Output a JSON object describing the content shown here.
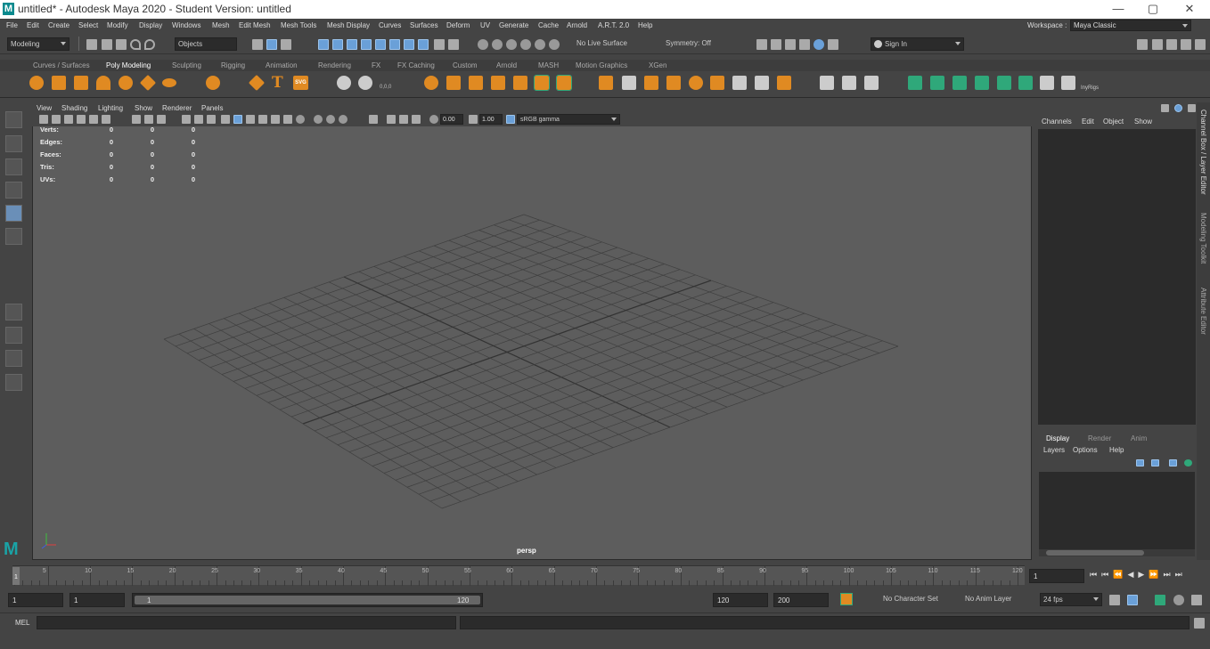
{
  "window": {
    "title": "untitled* - Autodesk Maya 2020 - Student Version: untitled",
    "logo": "M",
    "minimize": "—",
    "maximize": "▢",
    "close": "✕"
  },
  "menubar": {
    "items": [
      "File",
      "Edit",
      "Create",
      "Select",
      "Modify",
      "Display",
      "Windows",
      "Mesh",
      "Edit Mesh",
      "Mesh Tools",
      "Mesh Display",
      "Curves",
      "Surfaces",
      "Deform",
      "UV",
      "Generate",
      "Cache",
      "Arnold",
      "A.R.T. 2.0",
      "Help"
    ],
    "workspace_label": "Workspace :",
    "workspace_value": "Maya Classic"
  },
  "statusline": {
    "mode": "Modeling",
    "select_mode": "Objects",
    "live_surface": "No Live Surface",
    "symmetry": "Symmetry: Off",
    "sign_in": "Sign In"
  },
  "shelf": {
    "tabs": [
      "Curves / Surfaces",
      "Poly Modeling",
      "Sculpting",
      "Rigging",
      "Animation",
      "Rendering",
      "FX",
      "FX Caching",
      "Custom",
      "Arnold",
      "MASH",
      "Motion Graphics",
      "XGen"
    ],
    "active_tab": "Poly Modeling",
    "text_tool": "T",
    "svg_tool": "SVG",
    "mirror_label": "0,0,0",
    "iny_label": "InyRigs"
  },
  "viewport": {
    "menu": [
      "View",
      "Shading",
      "Lighting",
      "Show",
      "Renderer",
      "Panels"
    ],
    "exposure": "0.00",
    "gamma": "1.00",
    "color_space": "sRGB gamma",
    "camera": "persp",
    "hud": [
      {
        "label": "Verts:",
        "a": "0",
        "b": "0",
        "c": "0"
      },
      {
        "label": "Edges:",
        "a": "0",
        "b": "0",
        "c": "0"
      },
      {
        "label": "Faces:",
        "a": "0",
        "b": "0",
        "c": "0"
      },
      {
        "label": "Tris:",
        "a": "0",
        "b": "0",
        "c": "0"
      },
      {
        "label": "UVs:",
        "a": "0",
        "b": "0",
        "c": "0"
      }
    ]
  },
  "channelbox": {
    "menu": [
      "Channels",
      "Edit",
      "Object",
      "Show"
    ]
  },
  "layereditor": {
    "tabs": [
      "Display",
      "Render",
      "Anim"
    ],
    "menu": [
      "Layers",
      "Options",
      "Help"
    ]
  },
  "sidetabs": [
    "Channel Box / Layer Editor",
    "Modeling Toolkit",
    "Attribute Editor"
  ],
  "timeslider": {
    "ticks": [
      "5",
      "10",
      "15",
      "20",
      "25",
      "30",
      "35",
      "40",
      "45",
      "50",
      "55",
      "60",
      "65",
      "70",
      "75",
      "80",
      "85",
      "90",
      "95",
      "100",
      "105",
      "110",
      "115",
      "120"
    ],
    "current_frame_marker": "1",
    "current_frame": "1"
  },
  "rangeslider": {
    "start": "1",
    "playback_start": "1",
    "range_start_label": "1",
    "range_end_label": "120",
    "playback_end": "120",
    "end": "200",
    "character_set": "No Character Set",
    "anim_layer": "No Anim Layer",
    "fps": "24 fps"
  },
  "cmdline": {
    "language": "MEL"
  }
}
